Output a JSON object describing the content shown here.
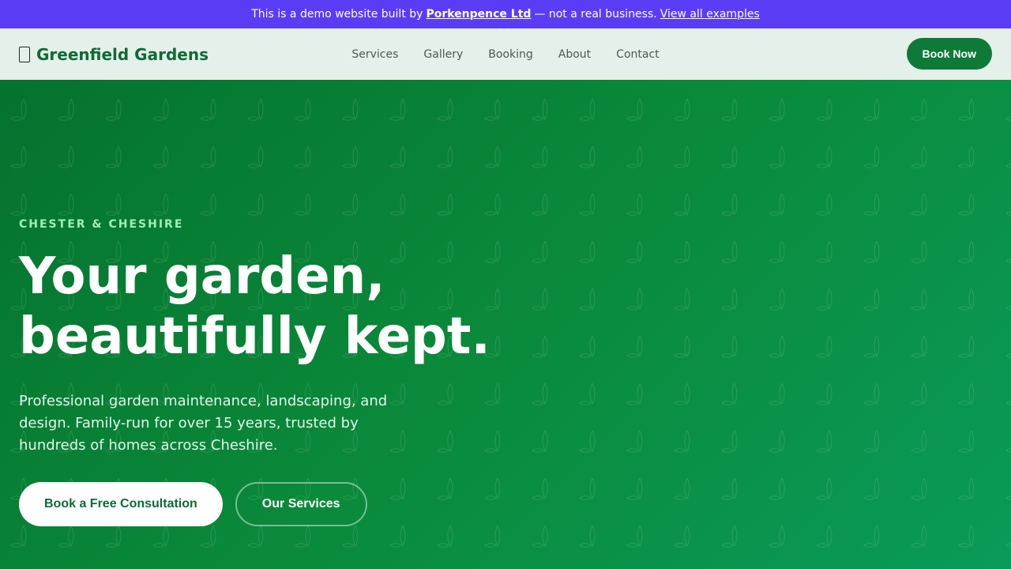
{
  "banner": {
    "prefix": "This is a demo website built by",
    "company": "Porkenpence Ltd",
    "middle": "— not a real business.",
    "examples_link": "View all examples"
  },
  "nav": {
    "logo_icon": "box-icon",
    "brand": "Greenfield Gardens",
    "links": [
      "Services",
      "Gallery",
      "Booking",
      "About",
      "Contact"
    ],
    "cta": "Book Now"
  },
  "hero": {
    "eyebrow": "CHESTER & CHESHIRE",
    "headline_line1": "Your garden,",
    "headline_line2": "beautifully kept.",
    "subtext": "Professional garden maintenance, landscaping, and design. Family-run for over 15 years, trusted by hundreds of homes across Cheshire.",
    "primary_cta": "Book a Free Consultation",
    "secondary_cta": "Our Services"
  },
  "colors": {
    "banner": "#5b3cf5",
    "brand_green": "#0d6b35",
    "accent_green": "#0e7a38",
    "eyebrow": "#9ef0b8"
  }
}
